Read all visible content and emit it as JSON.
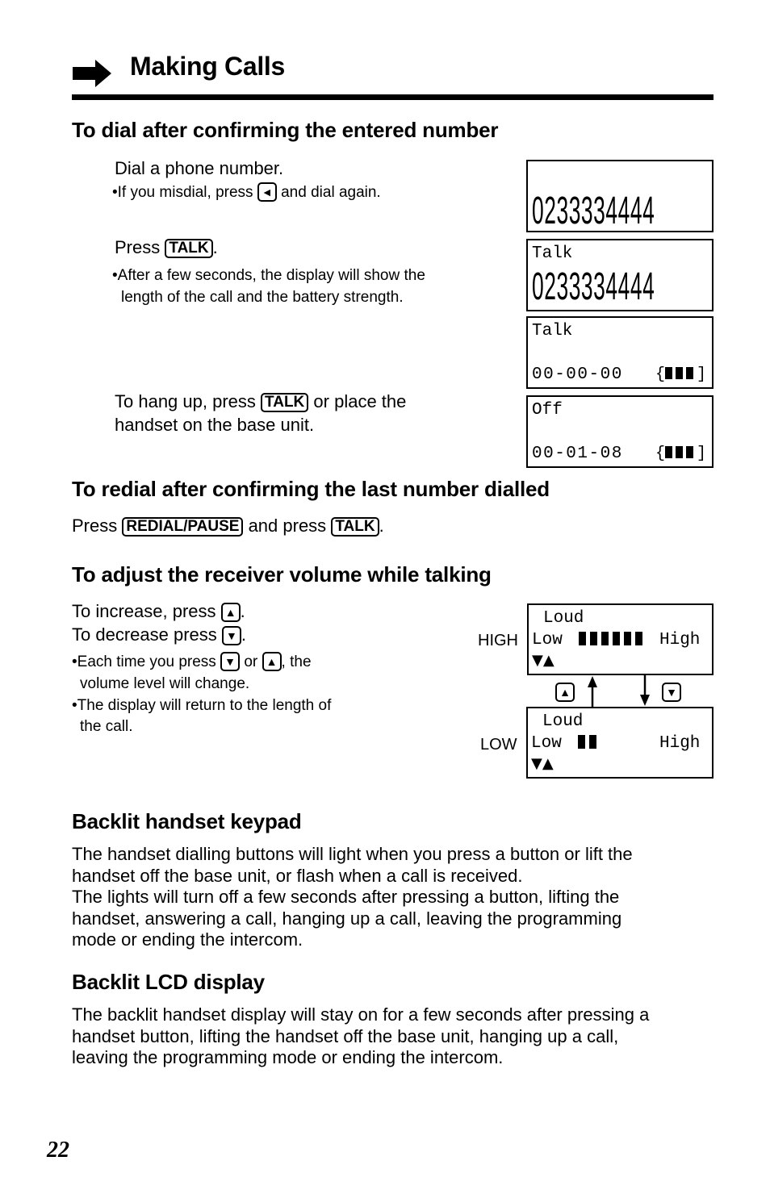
{
  "header": {
    "arrow_icon": "right-arrow-icon",
    "title": "Making Calls"
  },
  "dial_section": {
    "heading": "To dial after confirming the entered number",
    "step1": "Dial a phone number.",
    "step1_bullet_pre": "•If you misdial, press",
    "step1_bullet_key": "◄",
    "step1_bullet_post": "and dial again.",
    "step2_pre": "Press",
    "step2_key": "TALK",
    "step2_post": ".",
    "step2_bullet_line1": "•After a few seconds, the display will show the",
    "step2_bullet_line2": "length of the call and the battery strength.",
    "step3_pre": "To hang up, press",
    "step3_key": "TALK",
    "step3_post": "or place the",
    "step3_line2": "handset on the base unit.",
    "displays": [
      {
        "line1": "",
        "number": "0233334444"
      },
      {
        "line1": "Talk",
        "number": "0233334444"
      },
      {
        "line1": "Talk",
        "timer": "00-00-00",
        "battery_bars": 3,
        "battery_icon": "battery-icon"
      },
      {
        "line1": "Off",
        "timer": "00-01-08",
        "battery_bars": 3,
        "battery_icon": "battery-icon"
      }
    ]
  },
  "redial_section": {
    "heading": "To redial after confirming the last number dialled",
    "pre": "Press",
    "key1": "REDIAL/PAUSE",
    "mid": "and press",
    "key2": "TALK",
    "post": "."
  },
  "volume_section": {
    "heading": "To adjust the receiver volume while talking",
    "increase_pre": "To increase, press",
    "increase_key": "▲",
    "increase_post": ".",
    "decrease_pre": "To decrease press",
    "decrease_key": "▼",
    "decrease_post": ".",
    "bullet1_pre": "•Each time you press",
    "bullet1_key1": "▼",
    "bullet1_mid": "or",
    "bullet1_key2": "▲",
    "bullet1_post": ", the",
    "bullet1_line2": "volume level will change.",
    "bullet2_line1": "•The display will return to the length of",
    "bullet2_line2": "the call.",
    "high_label": "HIGH",
    "low_label": "LOW",
    "up_key": "▲",
    "down_key": "▼",
    "high_display": {
      "title": "Loud",
      "low": "Low",
      "high": "High",
      "level": 6,
      "arrows": "▼▲"
    },
    "low_display": {
      "title": "Loud",
      "low": "Low",
      "high": "High",
      "level": 2,
      "arrows": "▼▲"
    }
  },
  "keypad_section": {
    "heading": "Backlit handset keypad",
    "lines": [
      "The handset dialling buttons will light when you press a button or lift the",
      "handset off the base unit, or flash when a call is received.",
      "The lights will turn off a few seconds after pressing a button, lifting the",
      "handset, answering a call, hanging up a call, leaving the programming",
      "mode or ending the intercom."
    ]
  },
  "lcd_section": {
    "heading": "Backlit LCD display",
    "lines": [
      "The backlit handset display will stay on for a few seconds after pressing a",
      "handset button, lifting the handset off the base unit, hanging up a call,",
      "leaving the programming mode or ending the intercom."
    ]
  },
  "page_number": "22"
}
